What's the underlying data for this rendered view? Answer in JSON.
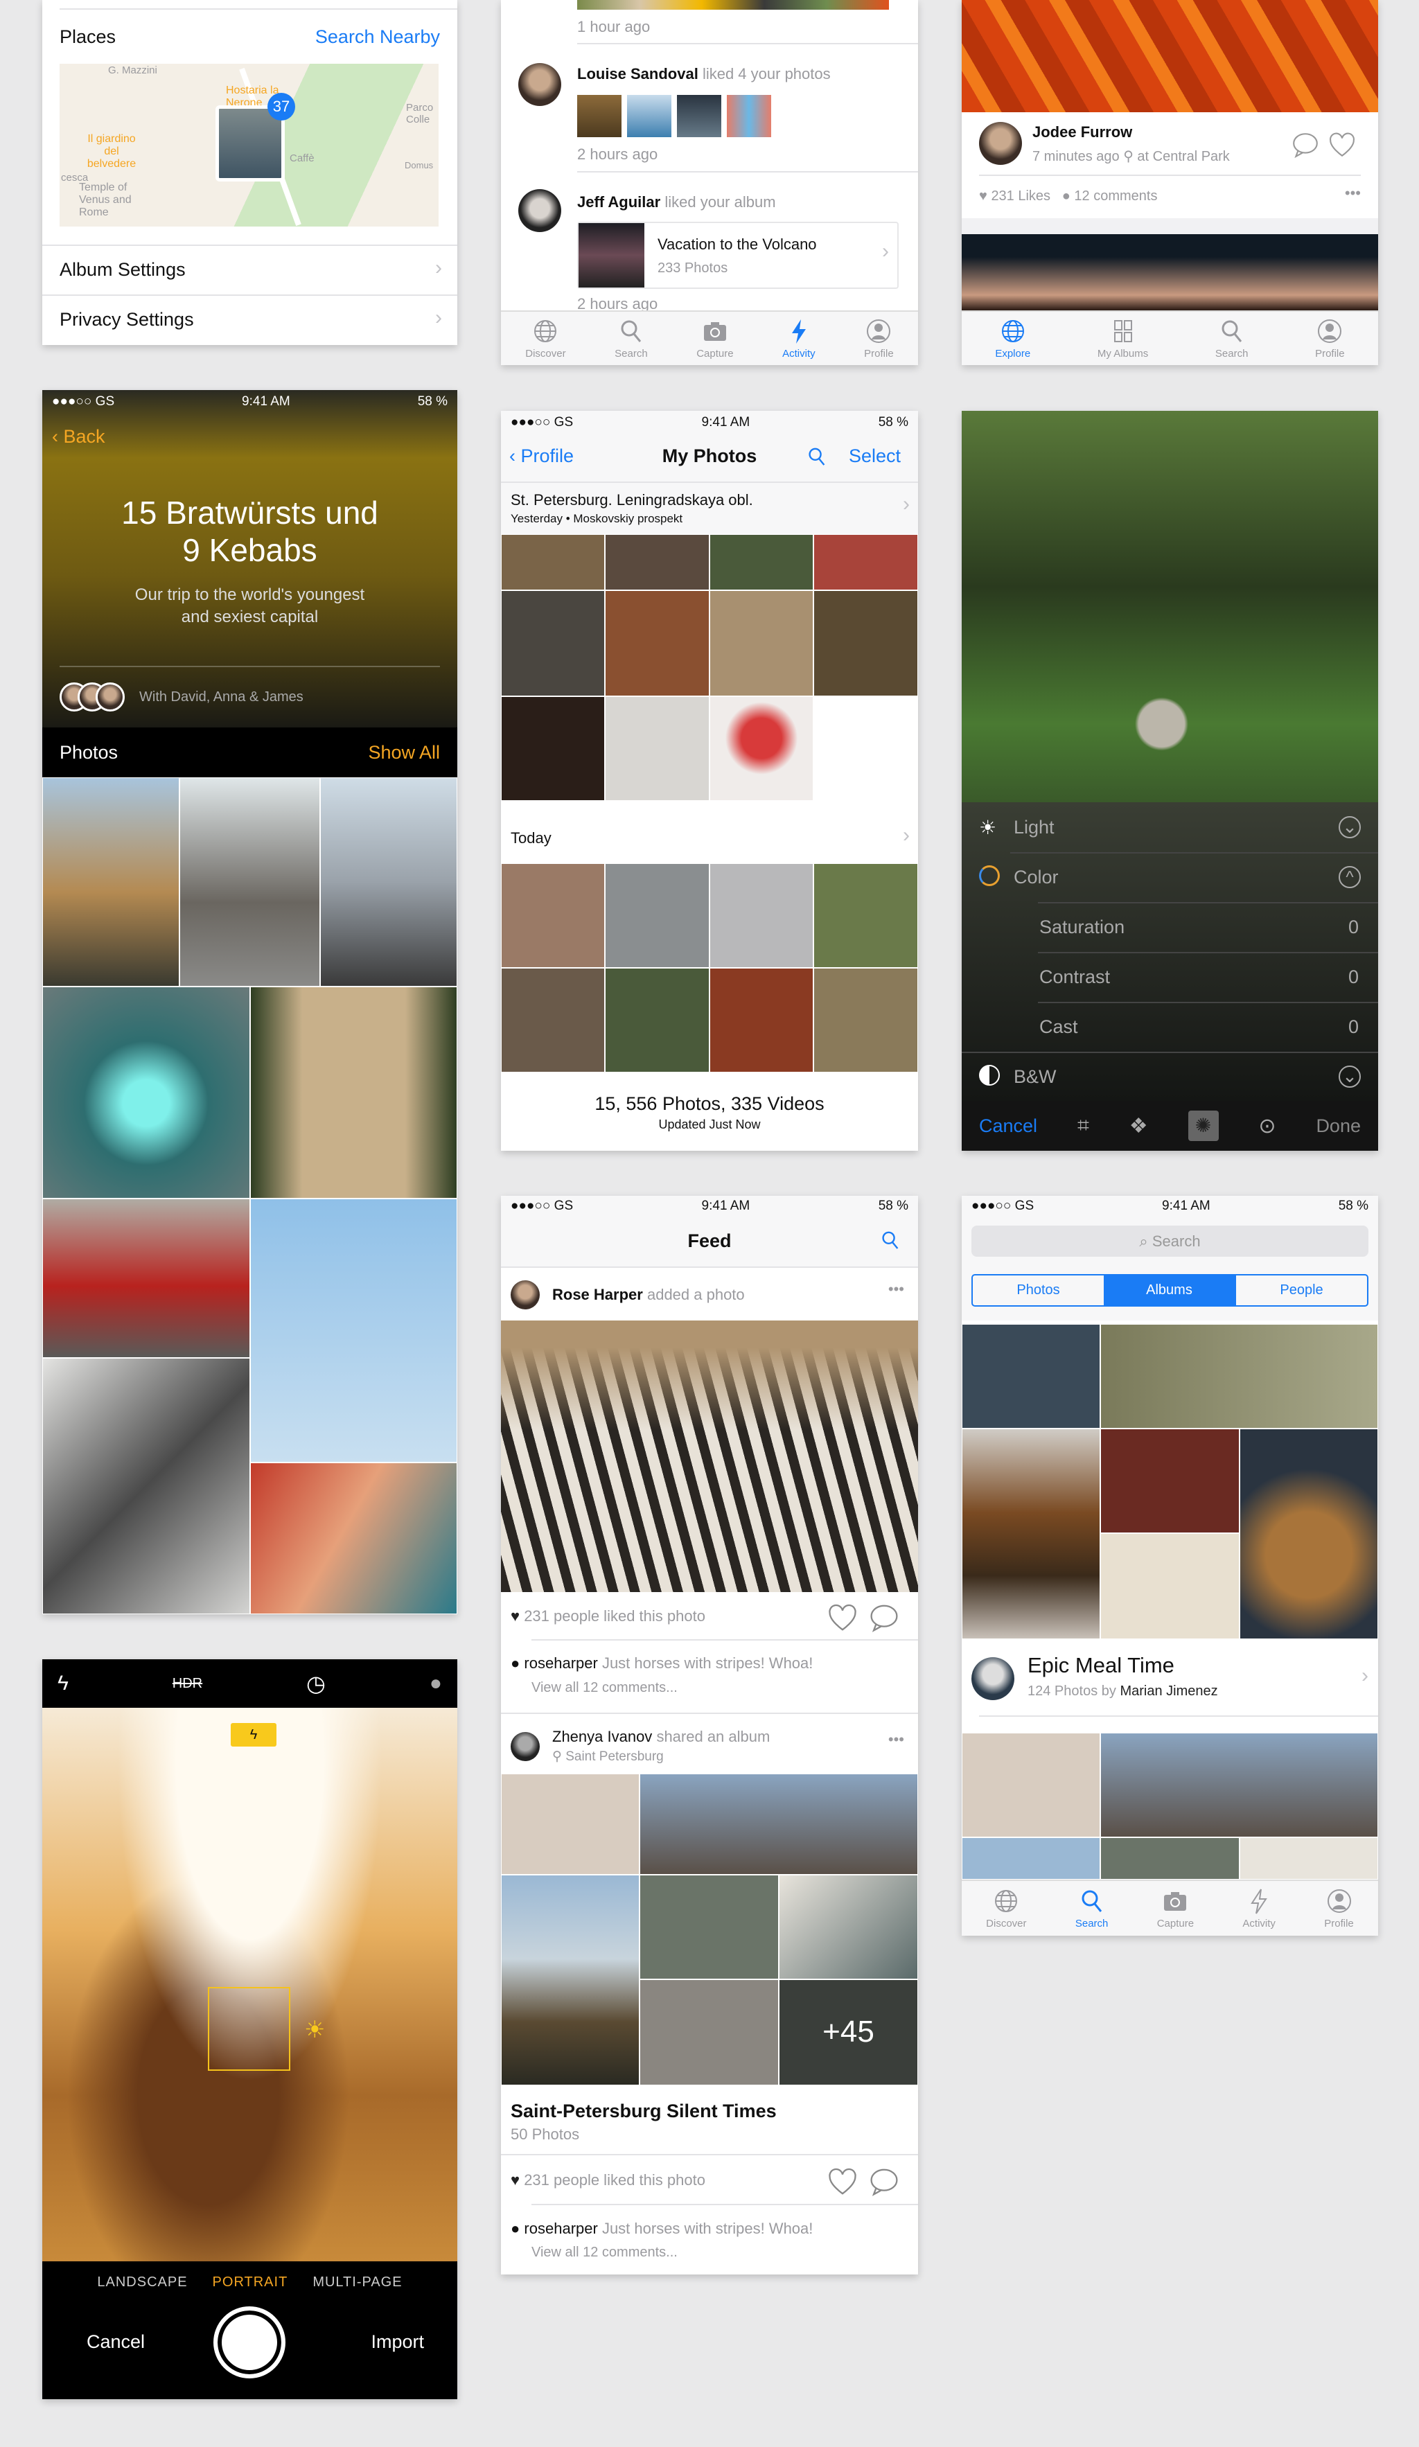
{
  "settings": {
    "places": "Places",
    "search_nearby": "Search Nearby",
    "map_badge": "37",
    "map_labels": [
      "G. Mazzini",
      "Hostaria la Nerone",
      "Parco Colle",
      "Il giardino del belvedere",
      "Caffè",
      "Domus",
      "Temple of Venus and Rome",
      "cesca"
    ],
    "album_settings": "Album Settings",
    "privacy_settings": "Privacy Settings"
  },
  "activity": {
    "time1": "1 hour ago",
    "louise_name": "Louise Sandoval",
    "louise_action": "liked 4 your photos",
    "time2": "2 hours ago",
    "jeff_name": "Jeff Aguilar",
    "jeff_action": "liked your album",
    "album_title": "Vacation to the Volcano",
    "album_count": "233 Photos",
    "time3": "2 hours ago",
    "tabs": [
      "Discover",
      "Search",
      "Capture",
      "Activity",
      "Profile"
    ],
    "active_tab": "Activity"
  },
  "explore": {
    "name": "Jodee Furrow",
    "meta": "7 minutes ago",
    "location": "at Central Park",
    "likes": "231 Likes",
    "comments": "12 comments",
    "tabs": [
      "Explore",
      "My Albums",
      "Search",
      "Profile"
    ],
    "active_tab": "Explore"
  },
  "status": {
    "carrier": "●●●○○ GS",
    "time": "9:41 AM",
    "battery": "58 %"
  },
  "story": {
    "back": "Back",
    "title_line1": "15 Bratwürsts und",
    "title_line2": "9 Kebabs",
    "subtitle_line1": "Our trip to the world's youngest",
    "subtitle_line2": "and sexiest capital",
    "with": "With David, Anna & James",
    "photos": "Photos",
    "show_all": "Show All"
  },
  "myphotos": {
    "back": "Profile",
    "title": "My Photos",
    "select": "Select",
    "location": "St. Petersburg. Leningradskaya obl.",
    "location_sub": "Yesterday • Moskovskiy prospekt",
    "today": "Today",
    "summary": "15, 556 Photos, 335 Videos",
    "updated": "Updated Just Now"
  },
  "editor": {
    "rows": [
      {
        "label": "Light",
        "value": ""
      },
      {
        "label": "Color",
        "value": ""
      },
      {
        "label": "Saturation",
        "value": "0"
      },
      {
        "label": "Contrast",
        "value": "0"
      },
      {
        "label": "Cast",
        "value": "0"
      },
      {
        "label": "B&W",
        "value": ""
      }
    ],
    "cancel": "Cancel",
    "done": "Done"
  },
  "feed": {
    "title": "Feed",
    "post1_user": "Rose Harper",
    "post1_action": "added a photo",
    "post1_likes": "231 people liked this photo",
    "comment_user": "roseharper",
    "comment_text": "Just horses with stripes! Whoa!",
    "view_all": "View all 12 comments...",
    "post2_user": "Zhenya Ivanov",
    "post2_action": "shared an album",
    "post2_location": "Saint Petersburg",
    "more_count": "+45",
    "album_title": "Saint-Petersburg Silent Times",
    "album_count": "50 Photos",
    "post2_likes": "231 people liked this photo"
  },
  "search": {
    "placeholder": "Search",
    "segments": [
      "Photos",
      "Albums",
      "People"
    ],
    "active_segment": "Albums",
    "album_title": "Epic Meal Time",
    "album_count": "124 Photos by",
    "album_author": "Marian Jimenez",
    "tabs": [
      "Discover",
      "Search",
      "Capture",
      "Activity",
      "Profile"
    ],
    "active_tab": "Search"
  },
  "camera": {
    "hdr": "HDR",
    "modes": [
      "LANDSCAPE",
      "PORTRAIT",
      "MULTI-PAGE"
    ],
    "active_mode": "PORTRAIT",
    "cancel": "Cancel",
    "import": "Import"
  },
  "colors": {
    "accent_blue": "#1a7cf5",
    "accent_orange": "#f5a623",
    "flash_yellow": "#f8c91c"
  }
}
